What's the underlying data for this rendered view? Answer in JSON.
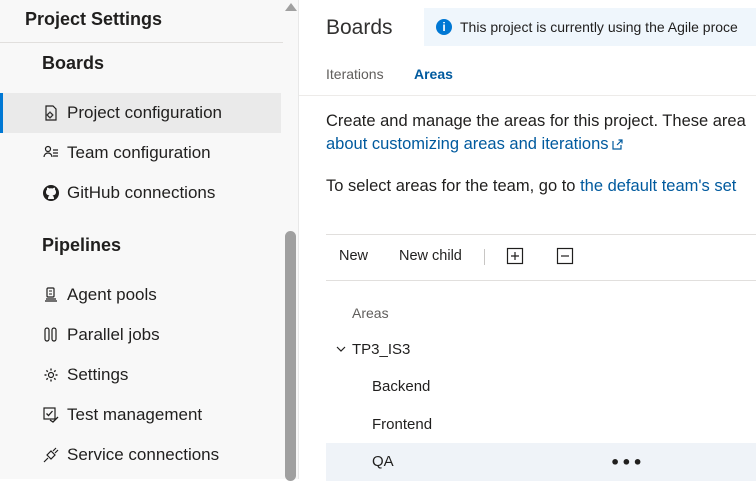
{
  "sidebar": {
    "title": "Project Settings",
    "sections": {
      "boards": "Boards",
      "pipelines": "Pipelines"
    },
    "boards_items": [
      {
        "label": "Project configuration",
        "icon": "gear-page-icon",
        "selected": true
      },
      {
        "label": "Team configuration",
        "icon": "team-icon"
      },
      {
        "label": "GitHub connections",
        "icon": "github-icon"
      }
    ],
    "pipelines_items": [
      {
        "label": "Agent pools",
        "icon": "agent-icon"
      },
      {
        "label": "Parallel jobs",
        "icon": "parallel-icon"
      },
      {
        "label": "Settings",
        "icon": "gear-icon"
      },
      {
        "label": "Test management",
        "icon": "test-icon"
      },
      {
        "label": "Service connections",
        "icon": "plug-icon"
      }
    ]
  },
  "main": {
    "title": "Boards",
    "banner": "This project is currently using the Agile proce",
    "tabs": [
      {
        "label": "Iterations",
        "active": false
      },
      {
        "label": "Areas",
        "active": true
      }
    ],
    "description_line1": "Create and manage the areas for this project. These area",
    "description_link": "about customizing areas and iterations",
    "team_line_prefix": "To select areas for the team, go to ",
    "team_line_link": "the default team's set",
    "toolbar": {
      "new": "New",
      "new_child": "New child",
      "expand_icon": "expand-all-icon",
      "collapse_icon": "collapse-all-icon"
    },
    "tree": {
      "column_header": "Areas",
      "root": "TP3_IS3",
      "children": [
        "Backend",
        "Frontend",
        "QA"
      ],
      "more_actions": "•••"
    }
  },
  "colors": {
    "accent": "#0078d4",
    "link": "#005a9e",
    "selected_row": "#eaeaea",
    "hover_row": "#eff3f8",
    "banner_bg": "#eff6fc"
  }
}
